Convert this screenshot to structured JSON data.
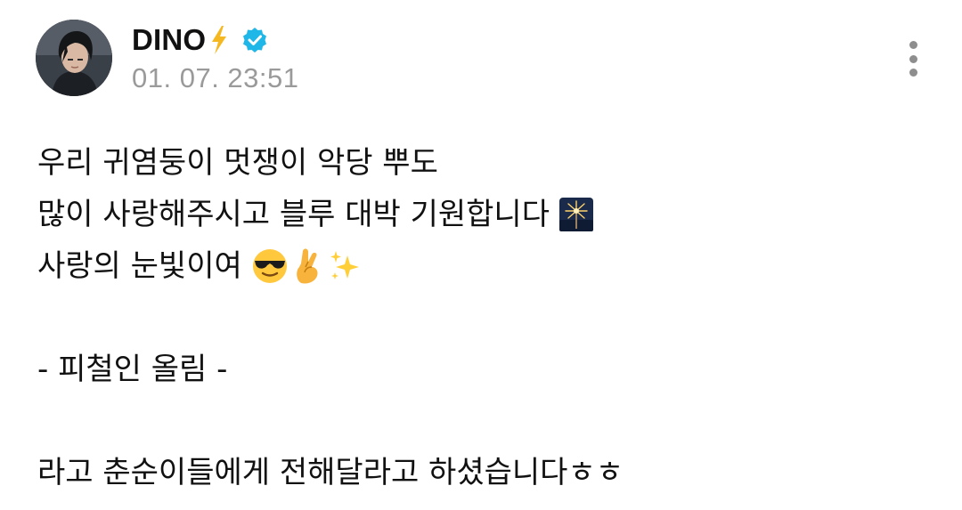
{
  "post": {
    "author": {
      "name": "DINO",
      "timestamp": "01. 07. 23:51"
    },
    "body": {
      "line1": "우리 귀염둥이 멋쟁이 악당 뿌도",
      "line2": "많이 사랑해주시고 블루 대박 기원합니다",
      "line3": "사랑의 눈빛이여",
      "line4": "",
      "line5": "- 피철인 올림 -",
      "line6": "",
      "line7": "라고 춘순이들에게 전해달라고 하셨습니다ㅎㅎ"
    },
    "icons": {
      "name_badge": "lightning-bolt-icon",
      "verified": "verified-badge-icon",
      "menu": "more-vertical-icon",
      "emoji_line2": "sparkler-emoji",
      "emoji_line3": [
        "sunglasses-face-emoji",
        "crossed-fingers-emoji",
        "sparkles-emoji"
      ]
    },
    "colors": {
      "timestamp": "#9a9a9a",
      "verified": "#1fb6e8",
      "bolt": "#f5b820",
      "text": "#111111"
    }
  }
}
